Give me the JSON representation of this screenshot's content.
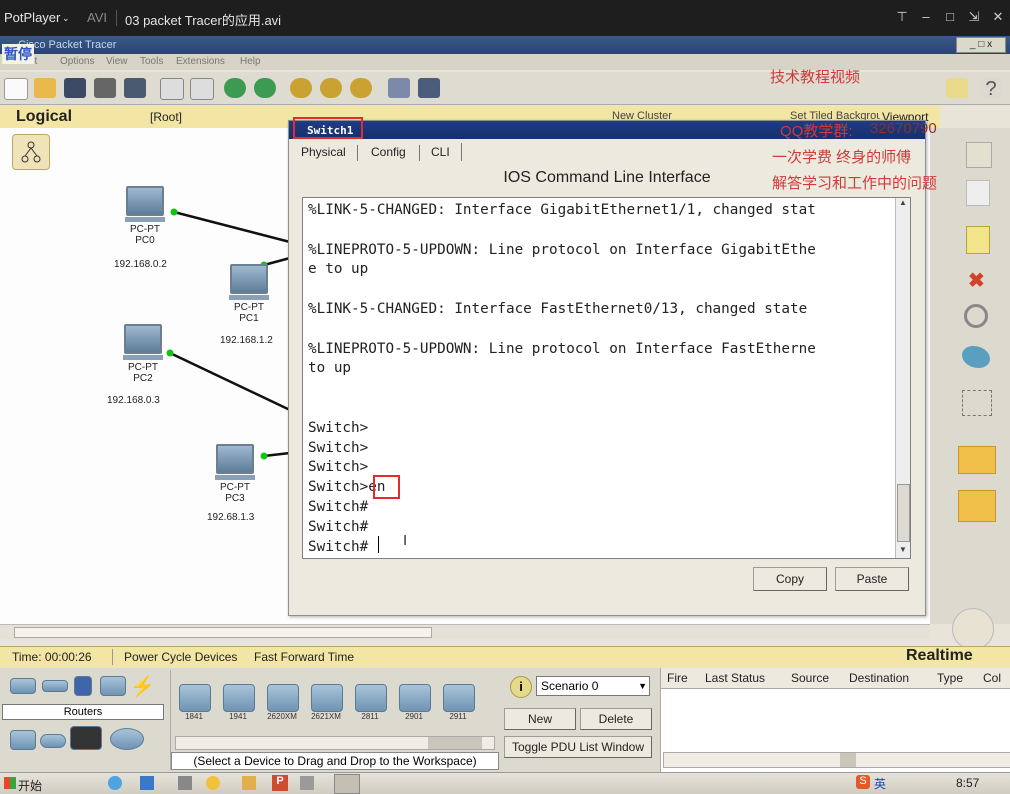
{
  "player": {
    "app_name": "PotPlayer",
    "format": "AVI",
    "file_title": "03 packet Tracer的应用.avi",
    "pause_label": "暂停"
  },
  "pt": {
    "title_bar": "Cisco Packet Tracer",
    "menu": [
      "Edit",
      "Options",
      "View",
      "Tools",
      "Extensions",
      "Help"
    ],
    "logical_label": "Logical",
    "root_label": "[Root]",
    "new_cluster": "New Cluster",
    "set_tiled": "Set Tiled Background",
    "viewport": "Viewport",
    "time_label": "Time: 00:00:26",
    "power_cycle": "Power Cycle Devices",
    "fast_forward": "Fast Forward Time",
    "realtime": "Realtime",
    "category_label": "Routers",
    "router_models": [
      "1841",
      "1941",
      "2620XM",
      "2621XM",
      "2811",
      "2901",
      "2911"
    ],
    "device_hint": "(Select a Device to Drag and Drop to the Workspace)",
    "scenario": "Scenario 0",
    "new_btn": "New",
    "delete_btn": "Delete",
    "toggle_pdu": "Toggle PDU List Window",
    "pdu_columns": [
      "Fire",
      "Last Status",
      "Source",
      "Destination",
      "Type",
      "Col"
    ]
  },
  "devices": [
    {
      "type": "PC-PT",
      "name": "PC0",
      "ip": "192.168.0.2"
    },
    {
      "type": "PC-PT",
      "name": "PC1",
      "ip": "192.168.1.2"
    },
    {
      "type": "PC-PT",
      "name": "PC2",
      "ip": "192.168.0.3"
    },
    {
      "type": "PC-PT",
      "name": "PC3",
      "ip": "192.68.1.3"
    }
  ],
  "switch_window": {
    "title": "Switch1",
    "tabs": [
      "Physical",
      "Config",
      "CLI"
    ],
    "heading": "IOS Command Line Interface",
    "cli_lines": [
      "%LINK-5-CHANGED: Interface GigabitEthernet1/1, changed stat",
      "",
      "%LINEPROTO-5-UPDOWN: Line protocol on Interface GigabitEthe",
      "e to up",
      "",
      "%LINK-5-CHANGED: Interface FastEthernet0/13, changed state",
      "",
      "%LINEPROTO-5-UPDOWN: Line protocol on Interface FastEtherne",
      "to up",
      "",
      "",
      "Switch>",
      "Switch>",
      "Switch>",
      "Switch>en",
      "Switch#",
      "Switch#",
      "Switch#"
    ],
    "copy_btn": "Copy",
    "paste_btn": "Paste"
  },
  "watermark": {
    "line1": "技术教程视频",
    "qq_label": "QQ教学群:",
    "qq_number": "32670790",
    "line3": "一次学费  终身的师傅",
    "line4": "解答学习和工作中的问题"
  },
  "taskbar": {
    "start": "开始",
    "ime": "英",
    "clock": "8:57"
  }
}
